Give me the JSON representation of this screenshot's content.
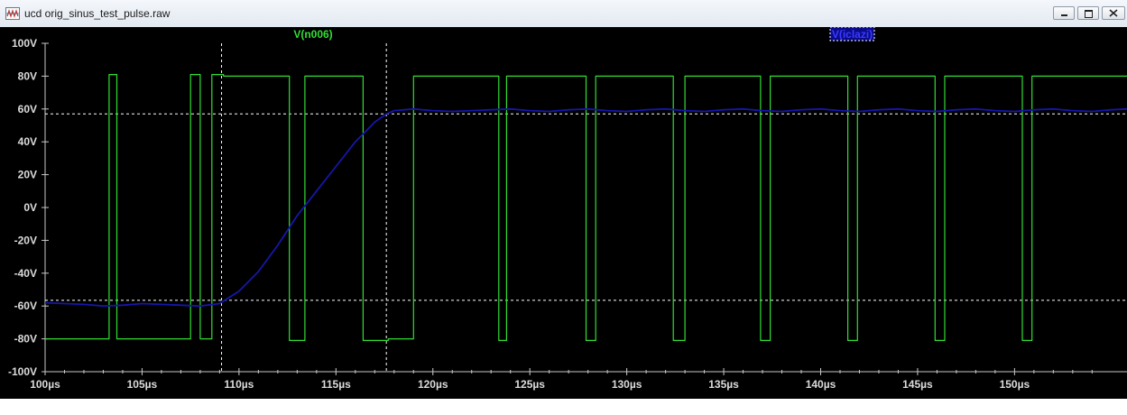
{
  "window": {
    "title": "ucd orig_sinus_test_pulse.raw",
    "app_icon": "waveform-icon",
    "buttons": [
      "minimize-icon",
      "restore-icon",
      "close-icon"
    ]
  },
  "colors": {
    "background": "#000000",
    "axis": "#c8c8c8",
    "labels": "#dcdcdc",
    "cursor": "#ffffff",
    "series_pulse": "#33dd33",
    "series_out": "#1616aa"
  },
  "chart_data": {
    "type": "line",
    "title": "",
    "xlabel": "",
    "ylabel": "",
    "xlim": [
      100,
      155.8
    ],
    "ylim": [
      -100,
      100
    ],
    "x_ticks": [
      100,
      105,
      110,
      115,
      120,
      125,
      130,
      135,
      140,
      145,
      150
    ],
    "x_tick_labels": [
      "100µs",
      "105µs",
      "110µs",
      "115µs",
      "120µs",
      "125µs",
      "130µs",
      "135µs",
      "140µs",
      "145µs",
      "150µs"
    ],
    "y_ticks": [
      -100,
      -80,
      -60,
      -40,
      -20,
      0,
      20,
      40,
      60,
      80,
      100
    ],
    "y_tick_labels": [
      "-100V",
      "-80V",
      "-60V",
      "-40V",
      "-20V",
      "0V",
      "20V",
      "40V",
      "60V",
      "80V",
      "100V"
    ],
    "grid": false,
    "cursors": {
      "vertical_x": [
        109.1,
        117.6
      ],
      "horizontal_y": [
        57,
        -56.5
      ]
    },
    "series": [
      {
        "name": "V(n006)",
        "label_color": "#33dd33",
        "x": [
          100,
          103.3,
          103.3,
          103.7,
          103.7,
          107.5,
          107.5,
          108.0,
          108.0,
          108.6,
          108.6,
          109.2,
          109.2,
          112.6,
          112.6,
          113.4,
          113.4,
          116.4,
          116.4,
          117.7,
          117.7,
          117.7,
          117.7,
          119.0,
          119.0,
          123.4,
          123.4,
          123.8,
          123.8,
          127.9,
          127.9,
          128.4,
          128.4,
          132.4,
          132.4,
          133.0,
          133.0,
          136.9,
          136.9,
          137.4,
          137.4,
          141.4,
          141.4,
          141.9,
          141.9,
          145.9,
          145.9,
          146.4,
          146.4,
          150.4,
          150.4,
          150.9,
          150.9,
          155.8
        ],
        "y": [
          -80,
          -80,
          81,
          81,
          -80,
          -80,
          81,
          81,
          -80,
          -80,
          81,
          81,
          80,
          80,
          -81,
          -81,
          80,
          80,
          -81,
          -81,
          -80,
          -80,
          -80,
          -80,
          80,
          80,
          -81,
          -81,
          80,
          80,
          -81,
          -81,
          80,
          80,
          -81,
          -81,
          80,
          80,
          -81,
          -81,
          80,
          80,
          -81,
          -81,
          80,
          80,
          -81,
          -81,
          80,
          80,
          -81,
          -81,
          80,
          80
        ]
      },
      {
        "name": "V(iclazi)",
        "label_color": "#1616aa",
        "x": [
          100,
          101,
          102,
          103,
          104,
          105,
          106,
          107,
          108,
          109,
          110,
          111,
          112,
          113,
          114,
          115,
          116,
          117,
          117.6,
          118,
          119,
          120,
          121,
          122,
          123,
          124,
          125,
          126,
          127,
          128,
          129,
          130,
          131,
          132,
          133,
          134,
          135,
          136,
          137,
          138,
          139,
          140,
          141,
          142,
          143,
          144,
          145,
          146,
          147,
          148,
          149,
          150,
          151,
          152,
          153,
          154,
          155,
          155.8
        ],
        "y": [
          -58,
          -58.5,
          -59,
          -60,
          -59.5,
          -58.5,
          -59,
          -59.5,
          -60,
          -58.5,
          -51,
          -39,
          -23,
          -5,
          10,
          25,
          40,
          52,
          57,
          59,
          60,
          59,
          58.5,
          59,
          59.5,
          60,
          59,
          58.5,
          59.5,
          60,
          59,
          58.5,
          59.5,
          60,
          59,
          58.5,
          59.5,
          60,
          59,
          58.5,
          59.5,
          60,
          59,
          58.5,
          59.5,
          60,
          59,
          58.5,
          59.5,
          60,
          59,
          58.5,
          59.5,
          60,
          59,
          58.5,
          59.5,
          60
        ]
      }
    ]
  }
}
